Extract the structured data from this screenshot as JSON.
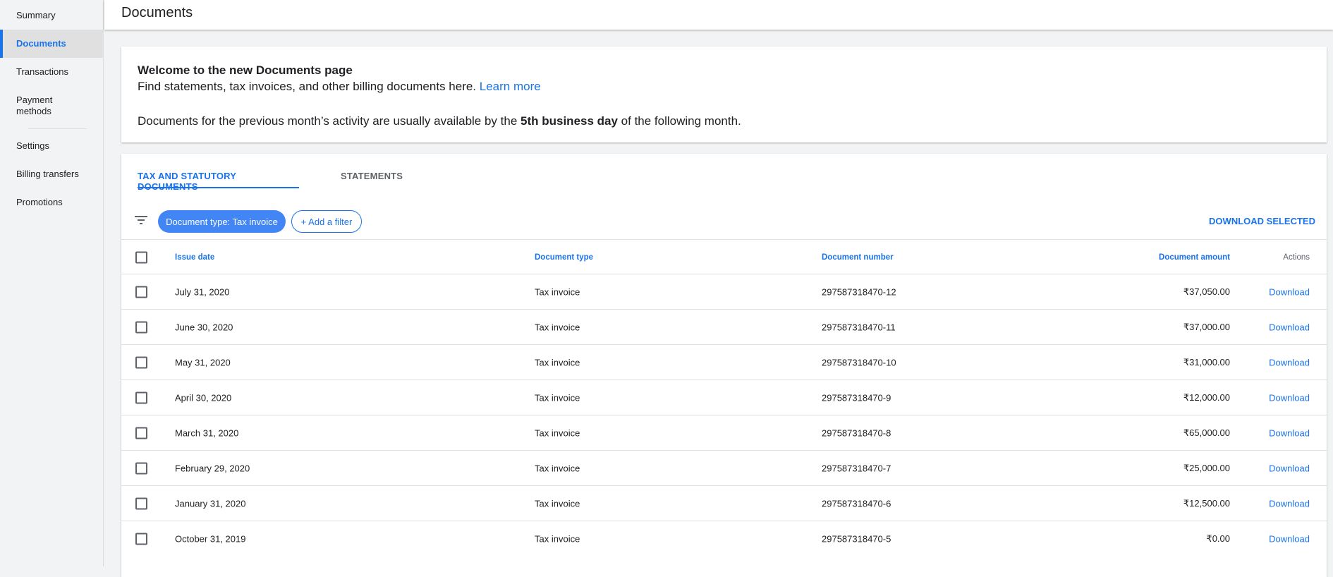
{
  "sidebar": {
    "items": [
      {
        "label": "Summary"
      },
      {
        "label": "Documents",
        "active": true
      },
      {
        "label": "Transactions"
      },
      {
        "label": "Payment methods"
      },
      {
        "label": "Settings"
      },
      {
        "label": "Billing transfers"
      },
      {
        "label": "Promotions"
      }
    ]
  },
  "header": {
    "title": "Documents"
  },
  "welcome": {
    "title": "Welcome to the new Documents page",
    "text": "Find statements, tax invoices, and other billing documents here. ",
    "link": "Learn more",
    "note_pre": "Documents for the previous month’s activity are usually available by the ",
    "note_bold": "5th business day",
    "note_post": " of the following month."
  },
  "tabs": [
    {
      "label": "TAX AND STATUTORY DOCUMENTS",
      "active": true
    },
    {
      "label": "STATEMENTS"
    }
  ],
  "filters": {
    "icon": "filter-icon",
    "chip": "Document type: Tax invoice",
    "add": "+ Add a filter",
    "download_selected": "DOWNLOAD SELECTED"
  },
  "table": {
    "headers": [
      "Issue date",
      "Document type",
      "Document number",
      "Document amount",
      "Actions"
    ],
    "rows": [
      {
        "date": "July 31, 2020",
        "type": "Tax invoice",
        "number": "297587318470-12",
        "amount": "₹37,050.00",
        "action": "Download"
      },
      {
        "date": "June 30, 2020",
        "type": "Tax invoice",
        "number": "297587318470-11",
        "amount": "₹37,000.00",
        "action": "Download"
      },
      {
        "date": "May 31, 2020",
        "type": "Tax invoice",
        "number": "297587318470-10",
        "amount": "₹31,000.00",
        "action": "Download"
      },
      {
        "date": "April 30, 2020",
        "type": "Tax invoice",
        "number": "297587318470-9",
        "amount": "₹12,000.00",
        "action": "Download"
      },
      {
        "date": "March 31, 2020",
        "type": "Tax invoice",
        "number": "297587318470-8",
        "amount": "₹65,000.00",
        "action": "Download"
      },
      {
        "date": "February 29, 2020",
        "type": "Tax invoice",
        "number": "297587318470-7",
        "amount": "₹25,000.00",
        "action": "Download"
      },
      {
        "date": "January 31, 2020",
        "type": "Tax invoice",
        "number": "297587318470-6",
        "amount": "₹12,500.00",
        "action": "Download"
      },
      {
        "date": "October 31, 2019",
        "type": "Tax invoice",
        "number": "297587318470-5",
        "amount": "₹0.00",
        "action": "Download"
      }
    ]
  },
  "colors": {
    "accent": "#1a73e8",
    "chip": "#4285f4"
  }
}
